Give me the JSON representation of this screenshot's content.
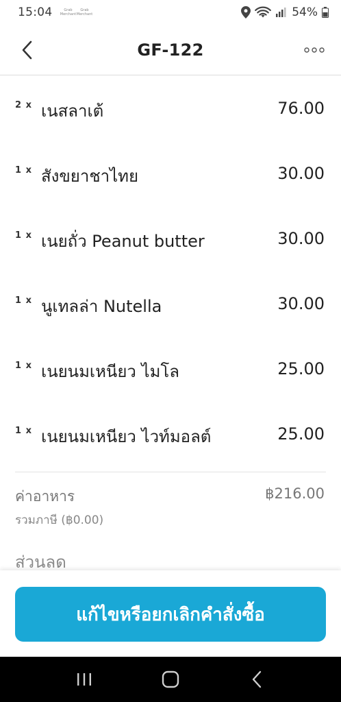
{
  "status_bar": {
    "time": "15:04",
    "notes": [
      {
        "line1": "Grab",
        "line2": "Merchant"
      },
      {
        "line1": "Grab",
        "line2": "Merchant"
      }
    ],
    "battery": "54%"
  },
  "header": {
    "title": "GF-122",
    "back_icon": "chevron-left-icon",
    "more_icon": "more-dots-icon"
  },
  "items": [
    {
      "qty": "2 x",
      "name": "เนสลาเต้",
      "price": "76.00"
    },
    {
      "qty": "1 x",
      "name": "สังขยาชาไทย",
      "price": "30.00"
    },
    {
      "qty": "1 x",
      "name": "เนยถั่ว Peanut butter",
      "price": "30.00"
    },
    {
      "qty": "1 x",
      "name": "นูเทลล่า Nutella",
      "price": "30.00"
    },
    {
      "qty": "1 x",
      "name": "เนยนมเหนียว ไมโล",
      "price": "25.00"
    },
    {
      "qty": "1 x",
      "name": "เนยนมเหนียว ไวท์มอลต์",
      "price": "25.00"
    }
  ],
  "summary": {
    "food_label": "ค่าอาหาร",
    "food_amount": "฿216.00",
    "tax_note": "รวมภาษี (฿0.00)",
    "discount_label": "ส่วนลด"
  },
  "action": {
    "button_label": "แก้ไขหรือยกเลิกคำสั่งซื้อ",
    "button_color": "#1aa8d6"
  }
}
